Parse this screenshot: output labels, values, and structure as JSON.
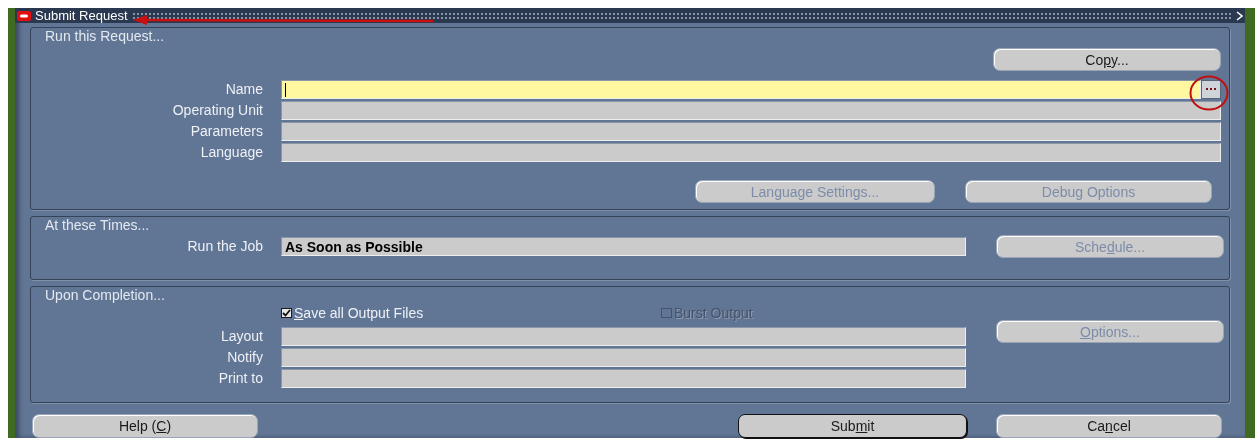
{
  "window": {
    "title": "Submit Request"
  },
  "run_request": {
    "title": "Run this Request...",
    "copy_button": {
      "label": [
        {
          "text": "Co"
        },
        {
          "text": "p",
          "underlined": true
        },
        {
          "text": "y..."
        }
      ],
      "disabled": false,
      "default": false
    },
    "fields": [
      {
        "label": "Name",
        "focused": true,
        "list_button": true
      },
      {
        "label": "Operating Unit",
        "focused": false,
        "list_button": false
      },
      {
        "label": "Parameters",
        "focused": false,
        "list_button": false
      },
      {
        "label": "Language",
        "focused": false,
        "list_button": false
      }
    ],
    "buttons": [
      {
        "label": [
          {
            "text": "Language Settings..."
          }
        ],
        "disabled": true,
        "default": false
      },
      {
        "label": [
          {
            "text": "Debug Options"
          }
        ],
        "disabled": true,
        "default": false
      }
    ]
  },
  "times": {
    "title": "At these Times...",
    "fields": [
      {
        "label": "Run the Job",
        "value": "As Soon as Possible",
        "focused": false,
        "list_button": false
      }
    ],
    "button": {
      "label": [
        {
          "text": "Sche"
        },
        {
          "text": "d",
          "underlined": true
        },
        {
          "text": "ule..."
        }
      ],
      "disabled": true,
      "default": false
    }
  },
  "completion": {
    "title": "Upon Completion...",
    "checkboxes": [
      {
        "label": [
          {
            "text": "S",
            "underlined": true
          },
          {
            "text": "ave all Output Files"
          }
        ],
        "checked": true,
        "disabled": false
      },
      {
        "label": [
          {
            "text": "Burst Output"
          }
        ],
        "checked": false,
        "disabled": true
      }
    ],
    "fields": [
      {
        "label": "Layout",
        "focused": false,
        "list_button": false
      },
      {
        "label": "Notify",
        "focused": false,
        "list_button": false
      },
      {
        "label": "Print to",
        "focused": false,
        "list_button": false
      }
    ],
    "button": {
      "label": [
        {
          "text": "O",
          "underlined": true
        },
        {
          "text": "ptions..."
        }
      ],
      "disabled": true,
      "default": false
    }
  },
  "footer_buttons": [
    {
      "label": [
        {
          "text": "Help ("
        },
        {
          "text": "C",
          "underlined": true
        },
        {
          "text": ")"
        }
      ],
      "disabled": false,
      "default": false
    },
    {
      "label": [
        {
          "text": "Sub"
        },
        {
          "text": "m",
          "underlined": true
        },
        {
          "text": "it"
        }
      ],
      "disabled": false,
      "default": true
    },
    {
      "label": [
        {
          "text": "Ca"
        },
        {
          "text": "n",
          "underlined": true
        },
        {
          "text": "cel"
        }
      ],
      "disabled": false,
      "default": false
    }
  ]
}
